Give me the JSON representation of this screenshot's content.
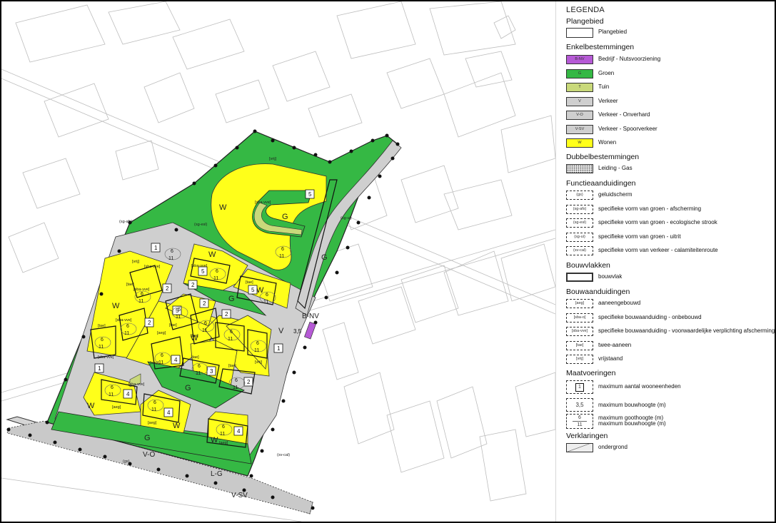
{
  "legend": {
    "title": "LEGENDA",
    "sections": {
      "plangebied": "Plangebied",
      "enkelbestemmingen": "Enkelbestemmingen",
      "dubbelbestemmingen": "Dubbelbestemmingen",
      "functieaanduidingen": "Functieaanduidingen",
      "bouwvlakken": "Bouwvlakken",
      "bouwaanduidingen": "Bouwaanduidingen",
      "maatvoeringen": "Maatvoeringen",
      "verklaringen": "Verklaringen"
    },
    "plangebied": {
      "label": "Plangebied"
    },
    "enkel": [
      {
        "code": "B-NV",
        "label": "Bedrijf - Nutsvoorziening",
        "color": "#b65ad6"
      },
      {
        "code": "G",
        "label": "Groen",
        "color": "#35b844"
      },
      {
        "code": "T",
        "label": "Tuin",
        "color": "#c9d97a"
      },
      {
        "code": "V",
        "label": "Verkeer",
        "color": "#cfcfcf"
      },
      {
        "code": "V-O",
        "label": "Verkeer - Onverhard",
        "color": "#cfcfcf"
      },
      {
        "code": "V-SV",
        "label": "Verkeer - Spoorverkeer",
        "color": "#cfcfcf"
      },
      {
        "code": "W",
        "label": "Wonen",
        "color": "#ffff1a"
      }
    ],
    "dubbel": [
      {
        "label": "Leiding - Gas"
      }
    ],
    "functie": [
      {
        "code": "(gs)",
        "label": "geluidscherm"
      },
      {
        "code": "(sg-afs)",
        "label": "specifieke vorm van groen - afscherming"
      },
      {
        "code": "(sg-esl)",
        "label": "specifieke vorm van groen - ecologische strook"
      },
      {
        "code": "(sg-ui)",
        "label": "specifieke vorm van groen - uitrit"
      },
      {
        "code": "(sv-cal)",
        "label": "specifieke vorm van verkeer - calamiteitenroute"
      }
    ],
    "bouwvlak": {
      "label": "bouwvlak"
    },
    "bouw": [
      {
        "code": "[aeg]",
        "label": "aaneengebouwd"
      },
      {
        "code": "[sba-o]",
        "label": "specifieke bouwaanduiding - onbebouwd"
      },
      {
        "code": "[sba-vve]",
        "label": "specifieke bouwaanduiding - voorwaardelijke verplichting afscherming"
      },
      {
        "code": "[tae]",
        "label": "twee-aaneen"
      },
      {
        "code": "[vrij]",
        "label": "vrijstaand"
      }
    ],
    "maat": [
      {
        "sym": "1",
        "label": "maximum aantal wooneenheden"
      },
      {
        "sym": "3,5",
        "label": "maximum bouwhoogte (m)"
      },
      {
        "sym_top": "6",
        "sym_bottom": "11",
        "label1": "maximum goothoogte (m)",
        "label2": "maximum bouwhoogte (m)"
      }
    ],
    "verklaring": [
      {
        "label": "ondergrond"
      }
    ]
  },
  "map": {
    "zone_labels": {
      "w": "W",
      "g": "G",
      "v": "V",
      "bnv": "B-NV",
      "vo": "V-O",
      "lg": "L-G",
      "vsv": "V-SV"
    },
    "annotations": {
      "vrij": "[vrij]",
      "sba_vve": "[sba-vve]",
      "tae": "[tae]",
      "aeg": "[aeg]",
      "sg_afs": "(sg-afs)",
      "sg_esl": "(sg-esl)",
      "sg_ui": "(sg-ui)",
      "sv_cal": "(sv-cal)",
      "gs": "(gs)"
    },
    "values": {
      "one": "1",
      "two": "2",
      "three": "3",
      "four": "4",
      "five": "5",
      "goot": "6",
      "bouw": "11",
      "bnv_height": "3,5"
    }
  }
}
